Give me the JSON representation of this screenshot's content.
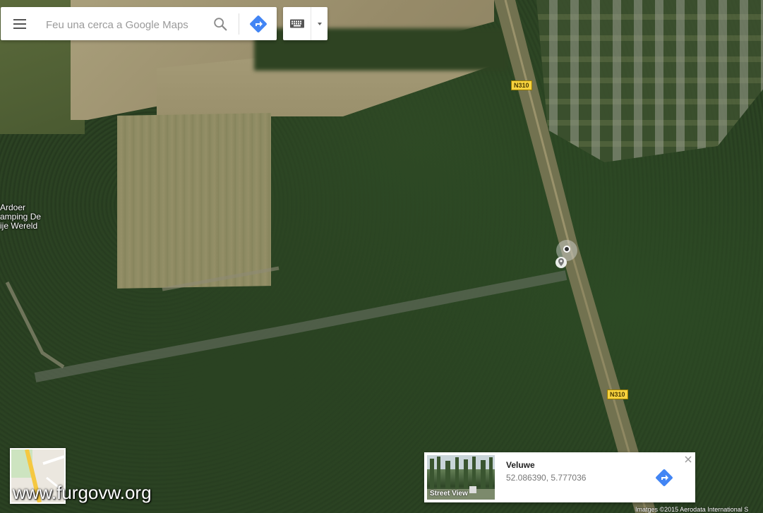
{
  "search": {
    "placeholder": "Feu una cerca a Google Maps"
  },
  "icons": {
    "menu": "menu-icon",
    "search": "search-icon",
    "directions": "directions-icon",
    "keyboard": "keyboard-icon",
    "dropdown": "caret-down-icon",
    "close": "close-icon",
    "location": "location-pin-icon"
  },
  "map": {
    "place_label": "Ardoer\namping De\nije Wereld",
    "road_shields": [
      "N310",
      "N310"
    ]
  },
  "street_view_card": {
    "thumb_label": "Street View",
    "title": "Veluwe",
    "coords": "52.086390, 5.777036"
  },
  "watermark": "www.furgovw.org",
  "imagery": "Imatges ©2015 Aerodata International S",
  "colors": {
    "directions_blue": "#4285f4",
    "shield_yellow": "#f7d23e"
  }
}
